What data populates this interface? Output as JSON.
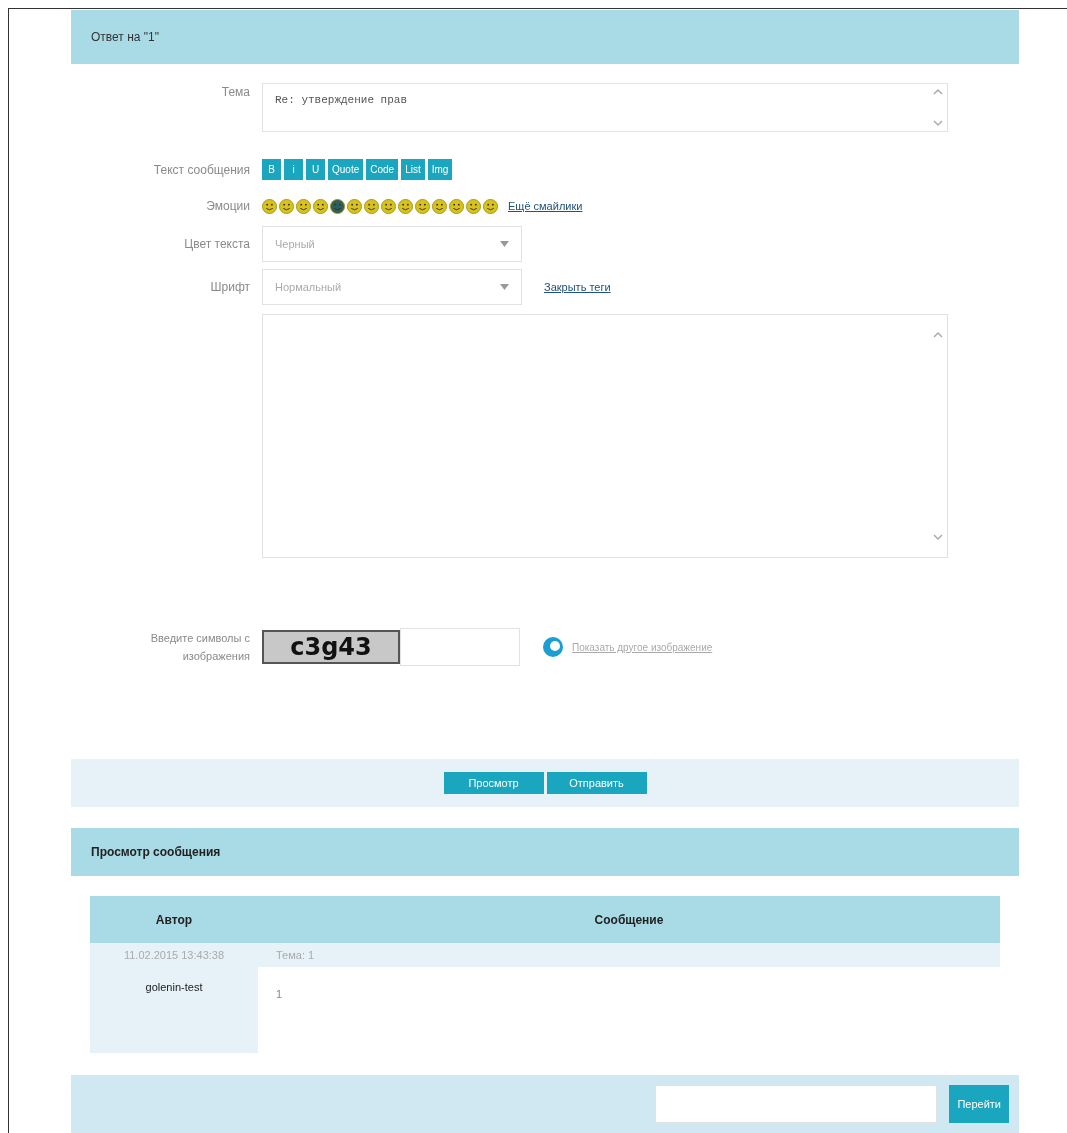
{
  "reply_header": {
    "title": "Ответ на \"1\""
  },
  "subject": {
    "label": "Тема",
    "value": "Re: утверждение прав"
  },
  "message": {
    "label": "Текст сообщения",
    "format_buttons": [
      "B",
      "i",
      "U",
      "Quote",
      "Code",
      "List",
      "Img"
    ]
  },
  "emoticons": {
    "label": "Эмоции",
    "more_link": "Ещё смайлики"
  },
  "text_color": {
    "label": "Цвет текста",
    "value": "Черный"
  },
  "font": {
    "label": "Шрифт",
    "value": "Нормальный",
    "close_tags_link": "Закрыть теги"
  },
  "captcha": {
    "label": "Введите символы с изображения",
    "image_text": "c3g43",
    "refresh_link": "Показать другое изображение"
  },
  "actions": [
    "Просмотр",
    "Отправить"
  ],
  "preview_header": {
    "title": "Просмотр сообщения"
  },
  "table": {
    "columns": [
      "Автор",
      "Сообщение"
    ],
    "rows": [
      {
        "date": "11.02.2015 13:43:38",
        "topic": "Тема: 1",
        "author": "golenin-test",
        "body": "1"
      }
    ]
  },
  "footer": {
    "go_button": "Перейти"
  }
}
